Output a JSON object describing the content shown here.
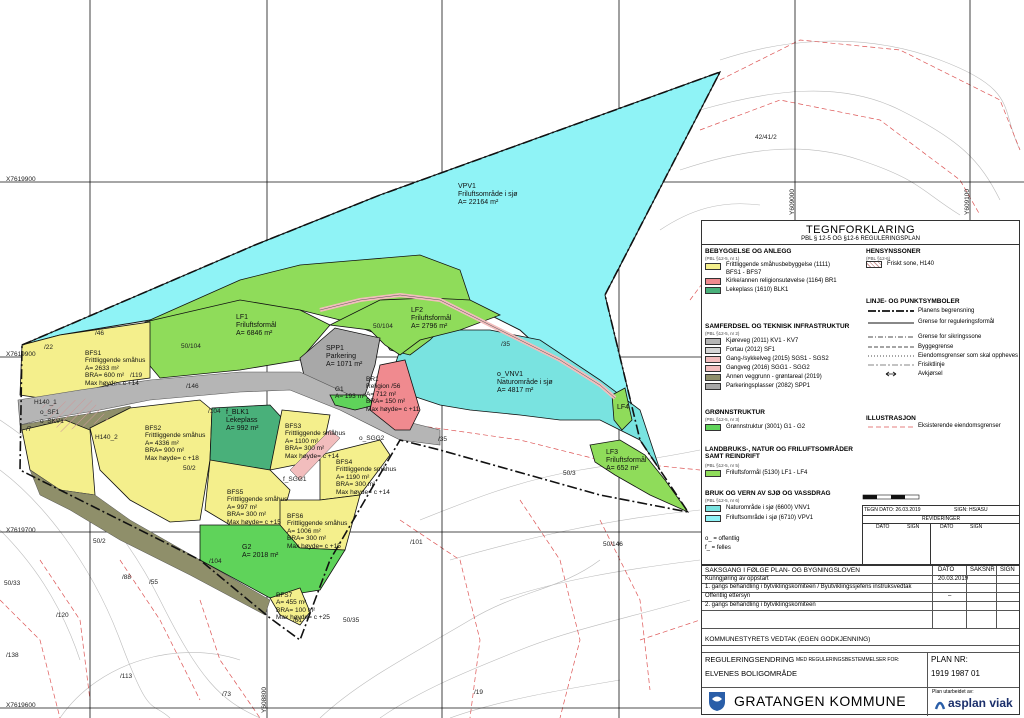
{
  "map": {
    "coords_left": [
      "X7619900",
      "X7619700",
      "X7619600"
    ],
    "coords_top": [
      "Y608700",
      "Y608800",
      "Y608900",
      "Y609000",
      "Y609100"
    ],
    "zones": {
      "vpf1": "VPV1\nFriluftsområde i sjø\nA= 22164 m²",
      "lf1": "LF1\nFriluftsformål\nA= 6846 m²",
      "lf2": "LF2\nFriluftsformål\nA= 2796 m²",
      "lf3": "LF3\nFriluftsformål\nA= 652 m²",
      "lf4": "LF4",
      "vnv1": "o_VNV1\nNaturområde i sjø\nA= 4817 m²",
      "spp1": "SPP1\nParkering\nA= 1071 m²",
      "br1": "BR1\nReligion /56\nA= 712 m²\nBRA= 150 m²\nMax høyde= c +11",
      "g1": "G1\nA= 193 m²",
      "g2": "G2\nA= 2018 m²",
      "blk1": "f_BLK1\nLekeplass\nA= 992 m²",
      "bfs1": "BFS1\nFrittliggende småhus\nA= 2633 m²\nBRA= 600 m²\nMax høyde= c +14",
      "bfs2": "BFS2\nFrittliggende småhus\nA= 4336 m²\nBRA= 900 m²\nMax høyde= c +18",
      "bfs3": "BFS3\nFrittliggende småhus\nA= 1100 m²\nBRA= 300 m²\nMax høyde= c +14",
      "bfs4": "BFS4\nFrittliggende småhus\nA= 1190 m²\nBRA= 300 m²\nMax høyde= c +14",
      "bfs5": "BFS5\nFrittliggende småhus\nA= 997 m²\nBRA= 300 m²\nMax høyde= c +15",
      "bfs6": "BFS6\nFrittliggende småhus\nA= 1006 m²\nBRA= 300 m²\nMax høyde= c +15",
      "bfs7": "BFS7\nA= 455 m²\nBRA= 100 m²\nMax høyde= c +25"
    },
    "small_labels": {
      "h140_1": "H140_1",
      "h140_2": "H140_2",
      "sf1": "o_SF1",
      "skv1": "o_SKV1",
      "sgg1": "f_SGG1",
      "sgg2": "o_SGG2",
      "gnr_42_41_2": "42/41/2",
      "p50_104a": "50/104",
      "p50_104b": "50/104",
      "p35": "/35",
      "p146": "/146",
      "p104": "/104",
      "p22": "/22",
      "p46": "/46",
      "p119": "/119",
      "p7": "/7",
      "p50_2": "50/2",
      "p50_3": "50/3",
      "p50_146": "50/146",
      "p101": "/101",
      "p88": "/88",
      "p55": "/55",
      "p120": "/120",
      "p138": "/138",
      "p113": "/113",
      "p73": "/73",
      "p19": "/19",
      "p61": "/61",
      "p50_35": "50/35",
      "p50_33": "50/33",
      "p50_2b": "50/2"
    }
  },
  "legend": {
    "title": "TEGNFORKLARING",
    "subtitle": "PBL § 12-5 OG §12-6 REGULERINGSPLAN",
    "sec_bebyggelse": "BEBYGGELSE OG ANLEGG",
    "sec_bebyggelse_sub": "(PBL §12-5, nr 1)",
    "bebyggelse_items": [
      {
        "label": "Frittliggende småhusbebyggelse (1111)",
        "sub": "BFS1 - BFS7",
        "color": "#f4ef8c"
      },
      {
        "label": "Kirke/annen religionsutøvelse (1164) BR1",
        "color": "#f08a8f"
      },
      {
        "label": "Lekeplass (1610) BLK1",
        "color": "#49b07a"
      }
    ],
    "sec_hensyn": "HENSYNSSONER",
    "sec_hensyn_sub": "(PBL §12-6)",
    "hensyn_item": "Friskt sone, H140",
    "sec_samferdsel": "SAMFERDSEL OG TEKNISK INFRASTRUKTUR",
    "sec_samferdsel_sub": "(PBL §12-5, nr 2)",
    "samferdsel_items": [
      {
        "label": "Kjøreveg (2011) KV1 - KV7",
        "color": "#b5b5b5"
      },
      {
        "label": "Fortau (2012) SF1",
        "color": "#d6d6d6"
      },
      {
        "label": "Gang-/sykkelveg (2015) SGS1 - SGS2",
        "color": "#f2bdbd"
      },
      {
        "label": "Gangveg (2016) SGG1 - SGG2",
        "color": "#f2bdbd"
      },
      {
        "label": "Annen veggrunn - grøntareal (2019)",
        "color": "#8f8f6a"
      },
      {
        "label": "Parkeringsplasser (2082) SPP1",
        "color": "#a8a8a8"
      }
    ],
    "sec_linje": "LINJE- OG PUNKTSYMBOLER",
    "linje_items": [
      "Planens begrensning",
      "Grense for reguleringsformål",
      "Grense for sikringssone",
      "Byggegrense",
      "Eiendomsgrenser som skal oppheves",
      "Frisiktlinje",
      "Avkjørsel"
    ],
    "sec_gron": "GRØNNSTRUKTUR",
    "sec_gron_sub": "(PBL §12-5, nr 3)",
    "gron_item": {
      "label": "Grønnstruktur (3001) G1 - G2",
      "color": "#5fd35a"
    },
    "sec_landbruk": "LANDBRUKS-, NATUR OG FRILUFTSOMRÅDER SAMT REINDRIFT",
    "sec_landbruk_sub": "(PBL §12-5, nr 5)",
    "landbruk_item": {
      "label": "Friluftsformål (5130) LF1 - LF4",
      "color": "#8fdc5a"
    },
    "sec_illustrasjon": "ILLUSTRASJON",
    "illustrasjon_item": "Eksisterende eiendomsgrenser",
    "sec_vann": "BRUK OG VERN AV SJØ OG VASSDRAG",
    "sec_vann_sub": "(PBL §12-5, nr 6)",
    "vann_items": [
      {
        "label": "Naturområde i sjø (6600) VNV1",
        "color": "#79e3e0"
      },
      {
        "label": "Friluftsområde i sjø (6710) VPV1",
        "color": "#8ff3f6"
      }
    ],
    "o_note": "o_  = offentlig",
    "f_note": "f_  = felles",
    "tegn_dato": "TEGN DATO: 26.03.2019",
    "sign_label": "SIGN: HS/ASU",
    "revisjoner": "REVIDERINGER",
    "dato": "DATO",
    "sign": "SIGN"
  },
  "titleblock": {
    "saksgang": "SAKSGANG I FØLGE PLAN- OG BYGNINGSLOVEN",
    "col_dato": "DATO",
    "col_saknr": "SAKSNR",
    "col_sign": "SIGN",
    "rows": [
      {
        "label": "Kunngjøring av oppstart",
        "dato": "20.03.2019"
      },
      {
        "label": "1. gangs behandling i bytviklingskomiteen / Byutviklingssjefens instruksvedtak",
        "dato": ""
      },
      {
        "label": "Offentlig ettersyn",
        "dato": "–"
      },
      {
        "label": "2. gangs behandling i bytviklingskomiteen",
        "dato": ""
      }
    ],
    "kommunestyre": "KOMMUNESTYRETS VEDTAK (EGEN GODKJENNING)",
    "type": "REGULERINGSENDRING",
    "type_sub": "MED REGULERINGSBESTEMMELSER FOR:",
    "name": "ELVENES BOLIGOMRÅDE",
    "plannr_label": "PLAN NR:",
    "plannr": "1919 1987 01",
    "kommune": "GRATANGEN KOMMUNE",
    "utarbeidet": "Plan utarbeidet av:",
    "firm": "asplan viak"
  }
}
